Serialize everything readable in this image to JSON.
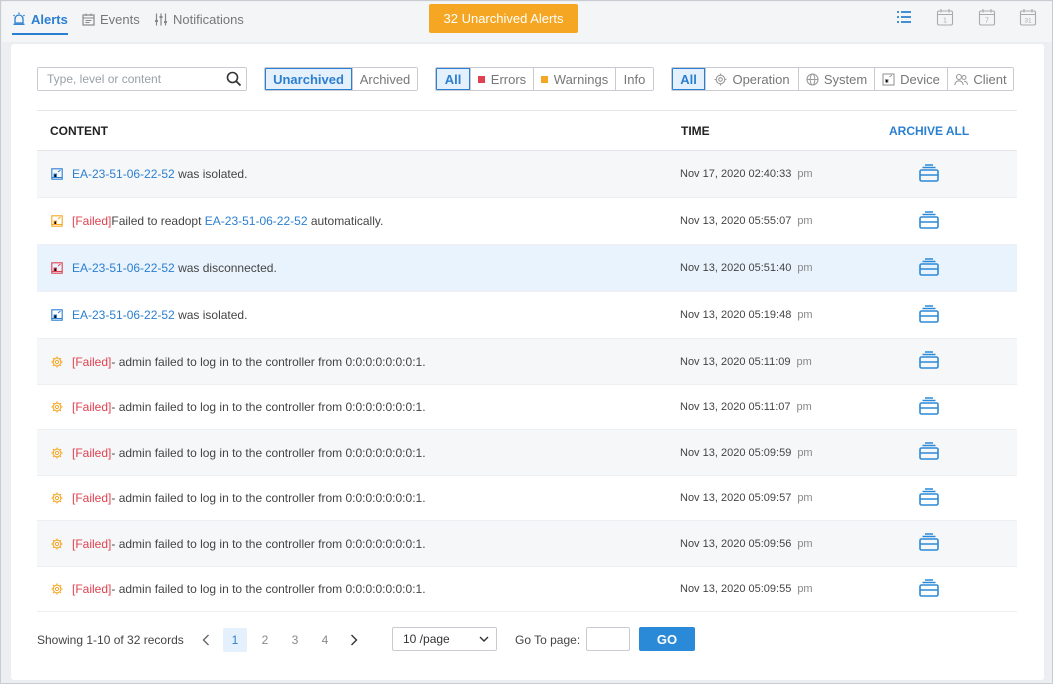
{
  "tabs": [
    {
      "label": "Alerts",
      "icon": "alarm-icon",
      "active": true
    },
    {
      "label": "Events",
      "icon": "calendar-icon",
      "active": false
    },
    {
      "label": "Notifications",
      "icon": "sliders-icon",
      "active": false
    }
  ],
  "unarchived_badge": "32 Unarchived Alerts",
  "view_icons": [
    "list-view-icon",
    "calendar-day-icon",
    "calendar-week-icon",
    "calendar-month-icon"
  ],
  "calendar_numbers": [
    "1",
    "7",
    "31"
  ],
  "search": {
    "placeholder": "Type, level or content",
    "value": ""
  },
  "archive_filter": {
    "options": [
      "Unarchived",
      "Archived"
    ],
    "selected": "Unarchived"
  },
  "level_filter": {
    "options": [
      {
        "label": "All",
        "dot": null
      },
      {
        "label": "Errors",
        "dot": "#e0414f"
      },
      {
        "label": "Warnings",
        "dot": "#f5a623"
      },
      {
        "label": "Info",
        "dot": null
      }
    ],
    "selected": "All"
  },
  "type_filter": {
    "options": [
      {
        "label": "All",
        "icon": null
      },
      {
        "label": "Operation",
        "icon": "gear-icon"
      },
      {
        "label": "System",
        "icon": "globe-icon"
      },
      {
        "label": "Device",
        "icon": "device-icon"
      },
      {
        "label": "Client",
        "icon": "users-icon"
      }
    ],
    "selected": "All"
  },
  "table": {
    "headers": {
      "content": "CONTENT",
      "time": "TIME",
      "action": "ARCHIVE ALL"
    },
    "rows": [
      {
        "icon": "device-blue-icon",
        "prefix": "",
        "link": "EA-23-51-06-22-52",
        "text": " was isolated.",
        "pre_text": "",
        "date": "Nov 17, 2020 02:40:33",
        "ampm": "pm"
      },
      {
        "icon": "device-orange-icon",
        "prefix": "[Failed]",
        "pre_text": "Failed to readopt ",
        "link": "EA-23-51-06-22-52",
        "text": " automatically.",
        "date": "Nov 13, 2020 05:55:07",
        "ampm": "pm"
      },
      {
        "icon": "device-red-icon",
        "prefix": "",
        "pre_text": "",
        "link": "EA-23-51-06-22-52",
        "text": " was disconnected.",
        "date": "Nov 13, 2020 05:51:40",
        "ampm": "pm"
      },
      {
        "icon": "device-blue-icon",
        "prefix": "",
        "pre_text": "",
        "link": "EA-23-51-06-22-52",
        "text": " was isolated.",
        "date": "Nov 13, 2020 05:19:48",
        "ampm": "pm"
      },
      {
        "icon": "gear-orange-icon",
        "prefix": "[Failed]",
        "pre_text": "- admin failed to log in to the controller from 0:0:0:0:0:0:0:1.",
        "link": "",
        "text": "",
        "date": "Nov 13, 2020 05:11:09",
        "ampm": "pm"
      },
      {
        "icon": "gear-orange-icon",
        "prefix": "[Failed]",
        "pre_text": "- admin failed to log in to the controller from 0:0:0:0:0:0:0:1.",
        "link": "",
        "text": "",
        "date": "Nov 13, 2020 05:11:07",
        "ampm": "pm"
      },
      {
        "icon": "gear-orange-icon",
        "prefix": "[Failed]",
        "pre_text": "- admin failed to log in to the controller from 0:0:0:0:0:0:0:1.",
        "link": "",
        "text": "",
        "date": "Nov 13, 2020 05:09:59",
        "ampm": "pm"
      },
      {
        "icon": "gear-orange-icon",
        "prefix": "[Failed]",
        "pre_text": "- admin failed to log in to the controller from 0:0:0:0:0:0:0:1.",
        "link": "",
        "text": "",
        "date": "Nov 13, 2020 05:09:57",
        "ampm": "pm"
      },
      {
        "icon": "gear-orange-icon",
        "prefix": "[Failed]",
        "pre_text": "- admin failed to log in to the controller from 0:0:0:0:0:0:0:1.",
        "link": "",
        "text": "",
        "date": "Nov 13, 2020 05:09:56",
        "ampm": "pm"
      },
      {
        "icon": "gear-orange-icon",
        "prefix": "[Failed]",
        "pre_text": "- admin failed to log in to the controller from 0:0:0:0:0:0:0:1.",
        "link": "",
        "text": "",
        "date": "Nov 13, 2020 05:09:55",
        "ampm": "pm"
      }
    ]
  },
  "pagination": {
    "records_text": "Showing 1-10 of 32 records",
    "pages": [
      "1",
      "2",
      "3",
      "4"
    ],
    "current": "1",
    "page_size": "10 /page",
    "goto_label": "Go To page:",
    "goto_value": "",
    "go_label": "GO"
  },
  "colors": {
    "accent": "#2b7fd0",
    "badge": "#f5a623",
    "error": "#e0414f",
    "highlight_row": "#e9f3fd"
  }
}
